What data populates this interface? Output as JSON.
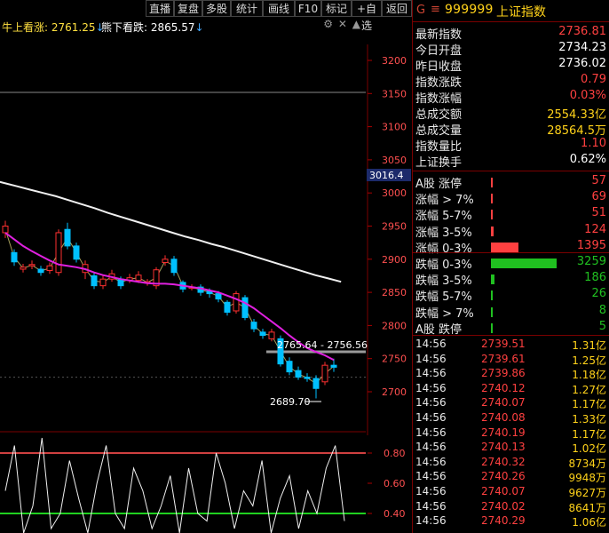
{
  "toolbar": {
    "buttons": [
      "直播",
      "复盘",
      "多股",
      "统计",
      "画线",
      "F10",
      "标记",
      "+自选",
      "返回"
    ]
  },
  "legend": {
    "bull_label": "牛上看涨:",
    "bull_value": "2761.25",
    "bull_arrow": "↓",
    "bear_label": "熊下看跌:",
    "bear_value": "2865.57",
    "bear_arrow": "↓"
  },
  "chart": {
    "price_axis": [
      "3200",
      "3150",
      "3100",
      "3050",
      "3000",
      "2950",
      "2900",
      "2850",
      "2800",
      "2750",
      "2700"
    ],
    "price_tag": "3016.4",
    "range_label": "2765.64 - 2756.56",
    "low_label": "2689.70",
    "osc_axis": [
      "0.80",
      "0.60",
      "0.40"
    ],
    "colors": {
      "up": "#ff3030",
      "down": "#00c0ff",
      "ma_fast": "#e020e0",
      "ma_slow": "#f0f0f0",
      "thin": "#e8e080"
    }
  },
  "chart_data": {
    "type": "candlestick",
    "candles": [
      {
        "o": 2940,
        "c": 2950,
        "h": 2958,
        "l": 2932
      },
      {
        "o": 2910,
        "c": 2896,
        "h": 2915,
        "l": 2890
      },
      {
        "o": 2885,
        "c": 2888,
        "h": 2893,
        "l": 2880
      },
      {
        "o": 2890,
        "c": 2892,
        "h": 2898,
        "l": 2885
      },
      {
        "o": 2885,
        "c": 2880,
        "h": 2890,
        "l": 2875
      },
      {
        "o": 2883,
        "c": 2890,
        "h": 2895,
        "l": 2878
      },
      {
        "o": 2880,
        "c": 2940,
        "h": 2945,
        "l": 2875
      },
      {
        "o": 2945,
        "c": 2920,
        "h": 2955,
        "l": 2915
      },
      {
        "o": 2920,
        "c": 2900,
        "h": 2925,
        "l": 2895
      },
      {
        "o": 2880,
        "c": 2892,
        "h": 2898,
        "l": 2870
      },
      {
        "o": 2875,
        "c": 2860,
        "h": 2880,
        "l": 2855
      },
      {
        "o": 2860,
        "c": 2870,
        "h": 2875,
        "l": 2855
      },
      {
        "o": 2870,
        "c": 2878,
        "h": 2884,
        "l": 2866
      },
      {
        "o": 2870,
        "c": 2860,
        "h": 2874,
        "l": 2855
      },
      {
        "o": 2868,
        "c": 2872,
        "h": 2878,
        "l": 2864
      },
      {
        "o": 2868,
        "c": 2876,
        "h": 2882,
        "l": 2864
      },
      {
        "o": 2864,
        "c": 2866,
        "h": 2870,
        "l": 2860
      },
      {
        "o": 2860,
        "c": 2884,
        "h": 2888,
        "l": 2855
      },
      {
        "o": 2895,
        "c": 2900,
        "h": 2906,
        "l": 2890
      },
      {
        "o": 2900,
        "c": 2880,
        "h": 2905,
        "l": 2875
      },
      {
        "o": 2865,
        "c": 2855,
        "h": 2868,
        "l": 2850
      },
      {
        "o": 2857,
        "c": 2858,
        "h": 2862,
        "l": 2853
      },
      {
        "o": 2858,
        "c": 2850,
        "h": 2862,
        "l": 2845
      },
      {
        "o": 2852,
        "c": 2848,
        "h": 2856,
        "l": 2842
      },
      {
        "o": 2848,
        "c": 2840,
        "h": 2852,
        "l": 2835
      },
      {
        "o": 2835,
        "c": 2820,
        "h": 2838,
        "l": 2815
      },
      {
        "o": 2822,
        "c": 2848,
        "h": 2852,
        "l": 2818
      },
      {
        "o": 2842,
        "c": 2812,
        "h": 2846,
        "l": 2808
      },
      {
        "o": 2805,
        "c": 2795,
        "h": 2810,
        "l": 2790
      },
      {
        "o": 2790,
        "c": 2785,
        "h": 2795,
        "l": 2780
      },
      {
        "o": 2780,
        "c": 2790,
        "h": 2795,
        "l": 2776
      },
      {
        "o": 2780,
        "c": 2742,
        "h": 2785,
        "l": 2738
      },
      {
        "o": 2746,
        "c": 2730,
        "h": 2752,
        "l": 2725
      },
      {
        "o": 2732,
        "c": 2722,
        "h": 2738,
        "l": 2718
      },
      {
        "o": 2722,
        "c": 2720,
        "h": 2728,
        "l": 2715
      },
      {
        "o": 2720,
        "c": 2705,
        "h": 2725,
        "l": 2690
      },
      {
        "o": 2715,
        "c": 2740,
        "h": 2745,
        "l": 2710
      },
      {
        "o": 2740,
        "c": 2737,
        "h": 2750,
        "l": 2730
      }
    ],
    "ma_fast": [
      2940,
      2930,
      2920,
      2912,
      2905,
      2898,
      2892,
      2890,
      2888,
      2885,
      2880,
      2876,
      2873,
      2870,
      2868,
      2866,
      2864,
      2863,
      2863,
      2862,
      2860,
      2858,
      2856,
      2853,
      2850,
      2845,
      2840,
      2834,
      2826,
      2816,
      2806,
      2796,
      2785,
      2775,
      2766,
      2760,
      2755,
      2748
    ],
    "ma_slow": [
      3020,
      3015,
      3010,
      3005,
      3000,
      2995,
      2989,
      2983,
      2977,
      2970,
      2964,
      2958,
      2952,
      2946,
      2940,
      2934,
      2929,
      2923,
      2918,
      2912,
      2906,
      2900,
      2894,
      2888,
      2882,
      2876,
      2871,
      2866
    ],
    "oscillator": [
      0.55,
      0.85,
      0.25,
      0.45,
      0.9,
      0.3,
      0.4,
      0.75,
      0.5,
      0.2,
      0.6,
      0.85,
      0.4,
      0.3,
      0.7,
      0.55,
      0.3,
      0.45,
      0.65,
      0.25,
      0.7,
      0.4,
      0.35,
      0.8,
      0.6,
      0.3,
      0.55,
      0.45,
      0.75,
      0.2,
      0.5,
      0.65,
      0.3,
      0.55,
      0.4,
      0.7,
      0.85,
      0.35
    ]
  },
  "stock": {
    "g": "G",
    "menu_icon": "menu-icon",
    "code": "999999",
    "name": "上证指数"
  },
  "quote": [
    {
      "label": "最新指数",
      "value": "2736.81",
      "color": "red"
    },
    {
      "label": "今日开盘",
      "value": "2734.23",
      "color": "white"
    },
    {
      "label": "昨日收盘",
      "value": "2736.02",
      "color": "white"
    },
    {
      "label": "指数涨跌",
      "value": "0.79",
      "color": "red"
    },
    {
      "label": "指数涨幅",
      "value": "0.03%",
      "color": "red"
    },
    {
      "label": "总成交额",
      "value": "2554.33亿",
      "color": "yel"
    },
    {
      "label": "总成交量",
      "value": "28564.5万",
      "color": "yel"
    },
    {
      "label": "指数量比",
      "value": "1.10",
      "color": "red"
    },
    {
      "label": "上证换手",
      "value": "0.62%",
      "color": "white"
    }
  ],
  "dist_up": [
    {
      "label": "A股 涨停",
      "value": "57",
      "bar": 0.02
    },
    {
      "label": "涨幅 > 7%",
      "value": "69",
      "bar": 0.02
    },
    {
      "label": "涨幅 5-7%",
      "value": "51",
      "bar": 0.02
    },
    {
      "label": "涨幅 3-5%",
      "value": "124",
      "bar": 0.04
    },
    {
      "label": "涨幅 0-3%",
      "value": "1395",
      "bar": 0.4
    }
  ],
  "dist_down": [
    {
      "label": "跌幅 0-3%",
      "value": "3259",
      "bar": 0.95
    },
    {
      "label": "跌幅 3-5%",
      "value": "186",
      "bar": 0.05
    },
    {
      "label": "跌幅 5-7%",
      "value": "26",
      "bar": 0.01
    },
    {
      "label": "跌幅 > 7%",
      "value": "8",
      "bar": 0.01
    },
    {
      "label": "A股 跌停",
      "value": "5",
      "bar": 0.01
    }
  ],
  "ticks": [
    {
      "time": "14:56",
      "price": "2739.51",
      "vol": "1.31亿"
    },
    {
      "time": "14:56",
      "price": "2739.61",
      "vol": "1.25亿"
    },
    {
      "time": "14:56",
      "price": "2739.86",
      "vol": "1.18亿"
    },
    {
      "time": "14:56",
      "price": "2740.12",
      "vol": "1.27亿"
    },
    {
      "time": "14:56",
      "price": "2740.07",
      "vol": "1.17亿"
    },
    {
      "time": "14:56",
      "price": "2740.08",
      "vol": "1.33亿"
    },
    {
      "time": "14:56",
      "price": "2740.19",
      "vol": "1.17亿"
    },
    {
      "time": "14:56",
      "price": "2740.13",
      "vol": "1.02亿"
    },
    {
      "time": "14:56",
      "price": "2740.32",
      "vol": "8734万"
    },
    {
      "time": "14:56",
      "price": "2740.26",
      "vol": "9948万"
    },
    {
      "time": "14:56",
      "price": "2740.07",
      "vol": "9627万"
    },
    {
      "time": "14:56",
      "price": "2740.02",
      "vol": "8641万"
    },
    {
      "time": "14:56",
      "price": "2740.29",
      "vol": "1.06亿"
    }
  ]
}
